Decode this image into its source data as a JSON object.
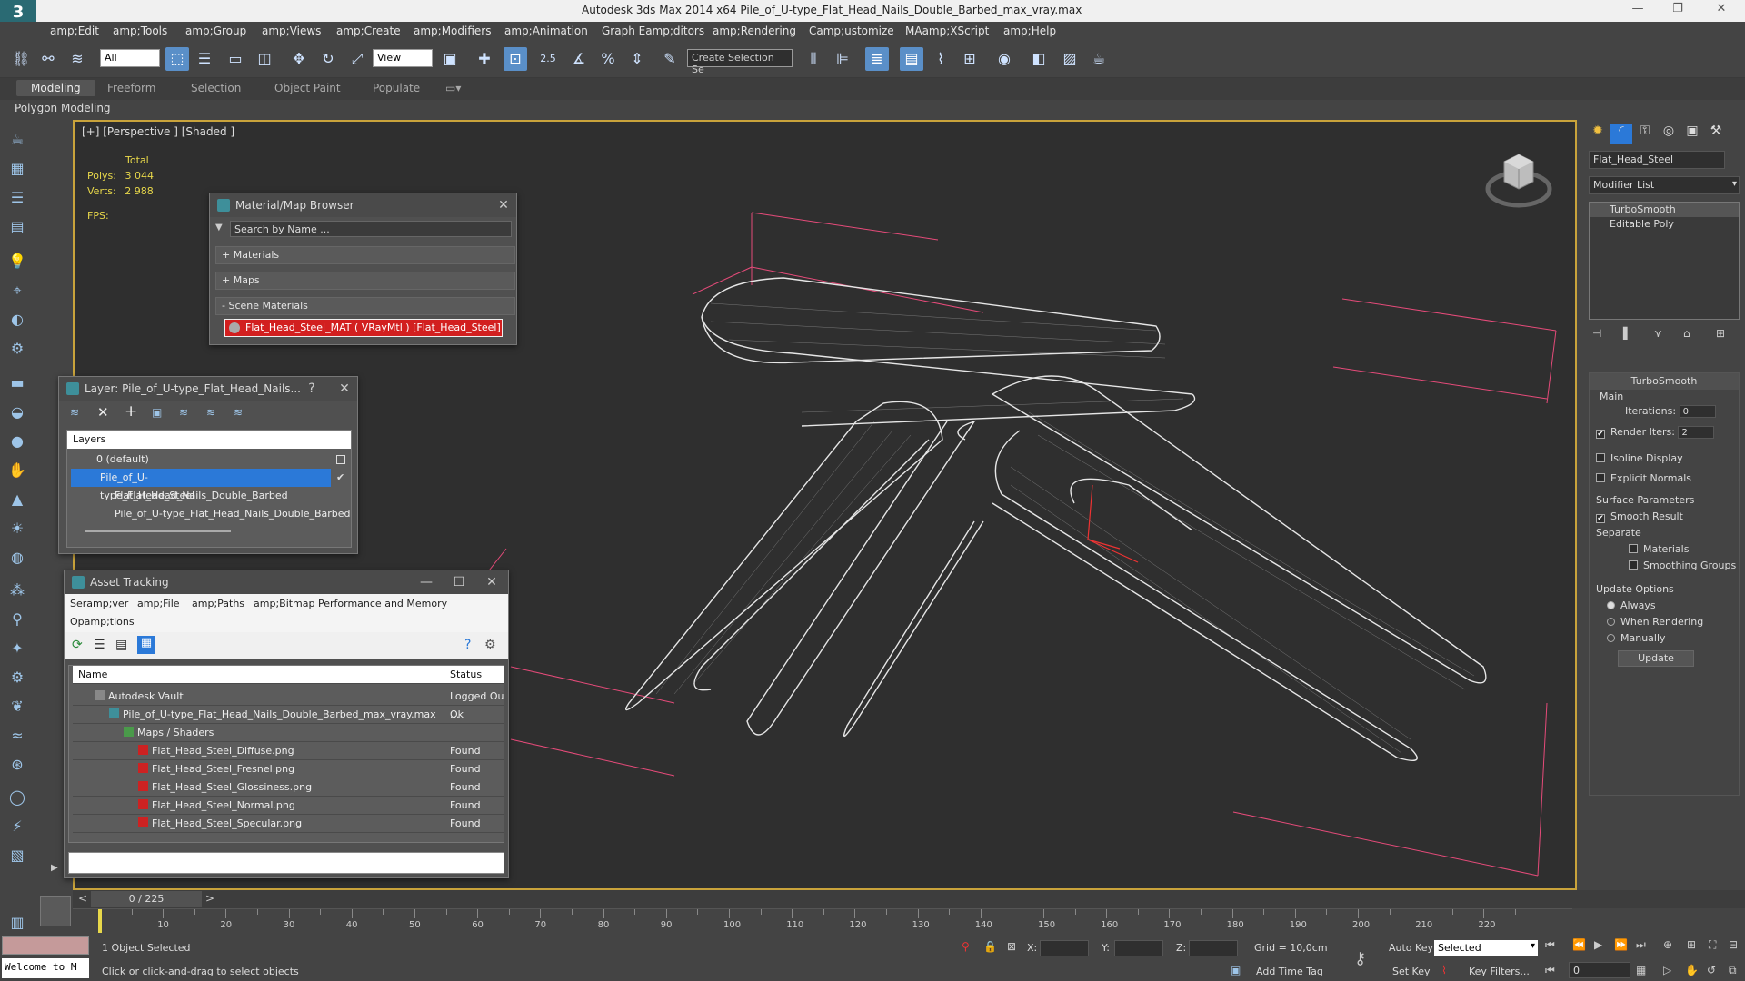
{
  "window": {
    "title": "Autodesk 3ds Max  2014 x64     Pile_of_U-type_Flat_Head_Nails_Double_Barbed_max_vray.max",
    "logo": "3"
  },
  "menu": [
    "amp;Edit",
    "amp;Tools",
    "amp;Group",
    "amp;Views",
    "amp;Create",
    "amp;Modifiers",
    "amp;Animation",
    "Graph Eamp;ditors",
    "amp;Rendering",
    "Camp;ustomize",
    "MAamp;XScript",
    "amp;Help"
  ],
  "toolbar": {
    "filter_value": "All",
    "refcoord_value": "View",
    "selection_set_placeholder": "Create Selection Se",
    "snap_label": "2.5"
  },
  "ribbon": {
    "tabs": [
      "Modeling",
      "Freeform",
      "Selection",
      "Object Paint",
      "Populate"
    ],
    "sub_label": "Polygon Modeling"
  },
  "viewport": {
    "label": "[+] [Perspective ] [Shaded ]",
    "stats_total": "Total",
    "polys_label": "Polys:",
    "polys_value": "3 044",
    "verts_label": "Verts:",
    "verts_value": "2 988",
    "fps_label": "FPS:"
  },
  "material_browser": {
    "title": "Material/Map Browser",
    "search_placeholder": "Search by Name ...",
    "sections": [
      "+ Materials",
      "+ Maps",
      "- Scene Materials"
    ],
    "scene_material": "Flat_Head_Steel_MAT ( VRayMtl ) [Flat_Head_Steel]"
  },
  "layer_window": {
    "title": "Layer: Pile_of_U-type_Flat_Head_Nails...",
    "help": "?",
    "header": "Layers",
    "rows": [
      "0 (default)",
      "Pile_of_U-type_Flat_Head_Nails_Double_Barbed",
      "Flat_Head_Steel",
      "Pile_of_U-type_Flat_Head_Nails_Double_Barbed"
    ]
  },
  "asset_tracking": {
    "title": "Asset Tracking",
    "menu": [
      "Seramp;ver",
      "amp;File",
      "amp;Paths",
      "amp;Bitmap Performance and Memory",
      "Opamp;tions"
    ],
    "col_name": "Name",
    "col_status": "Status",
    "rows": [
      {
        "name": "Autodesk Vault",
        "status": "Logged Out ...",
        "indent": 24
      },
      {
        "name": "Pile_of_U-type_Flat_Head_Nails_Double_Barbed_max_vray.max",
        "status": "Ok",
        "indent": 40
      },
      {
        "name": "Maps / Shaders",
        "status": "",
        "indent": 56
      },
      {
        "name": "Flat_Head_Steel_Diffuse.png",
        "status": "Found",
        "indent": 72
      },
      {
        "name": "Flat_Head_Steel_Fresnel.png",
        "status": "Found",
        "indent": 72
      },
      {
        "name": "Flat_Head_Steel_Glossiness.png",
        "status": "Found",
        "indent": 72
      },
      {
        "name": "Flat_Head_Steel_Normal.png",
        "status": "Found",
        "indent": 72
      },
      {
        "name": "Flat_Head_Steel_Specular.png",
        "status": "Found",
        "indent": 72
      }
    ]
  },
  "command_panel": {
    "object_name": "Flat_Head_Steel",
    "modifier_list": "Modifier List",
    "stack": [
      "TurboSmooth",
      "Editable Poly"
    ],
    "turbosmooth_title": "TurboSmooth",
    "main_label": "Main",
    "iterations_label": "Iterations:",
    "iterations_value": "0",
    "render_iters_label": "Render Iters:",
    "render_iters_value": "2",
    "isoline": "Isoline Display",
    "explicit_normals": "Explicit Normals",
    "surface_params": "Surface Parameters",
    "smooth_result": "Smooth Result",
    "separate": "Separate",
    "materials": "Materials",
    "smoothing_groups": "Smoothing Groups",
    "update_options": "Update Options",
    "always": "Always",
    "when_rendering": "When Rendering",
    "manually": "Manually",
    "update_button": "Update"
  },
  "timeline": {
    "frame_range": "0 / 225",
    "ticks": [
      "10",
      "20",
      "30",
      "40",
      "50",
      "60",
      "70",
      "80",
      "90",
      "100",
      "110",
      "120",
      "130",
      "140",
      "150",
      "160",
      "170",
      "180",
      "190",
      "200",
      "210",
      "220"
    ]
  },
  "statusbar": {
    "welcome": "Welcome to M",
    "selected": "1 Object Selected",
    "prompt": "Click or click-and-drag to select objects",
    "x_label": "X:",
    "y_label": "Y:",
    "z_label": "Z:",
    "grid": "Grid = 10,0cm",
    "add_time_tag": "Add Time Tag",
    "auto_key": "Auto Key",
    "set_key": "Set Key",
    "selected_dropdown": "Selected",
    "key_filters": "Key Filters...",
    "frame_value": "0"
  }
}
